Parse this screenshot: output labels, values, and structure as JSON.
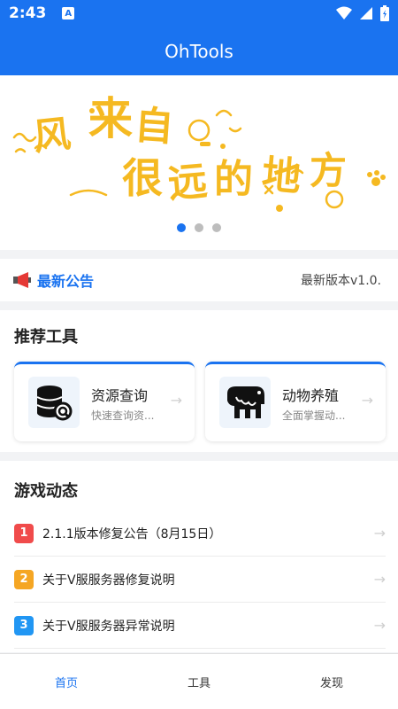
{
  "status_bar": {
    "time": "2:43",
    "notification_icon": "A",
    "icons": [
      "wifi-icon",
      "signal-icon",
      "battery-icon"
    ]
  },
  "app_bar": {
    "title": "OhTools"
  },
  "banner": {
    "art_text": "风来自很远的地方",
    "slides": 3,
    "active_slide": 0
  },
  "notice": {
    "icon": "megaphone-icon",
    "label": "最新公告",
    "version_text": "最新版本v1.0."
  },
  "tools": {
    "title": "推荐工具",
    "items": [
      {
        "name": "资源查询",
        "desc": "快速查询资...",
        "icon": "database-search-icon"
      },
      {
        "name": "动物养殖",
        "desc": "全面掌握动...",
        "icon": "animal-icon"
      }
    ]
  },
  "news": {
    "title": "游戏动态",
    "items": [
      {
        "num": "1",
        "text": "2.1.1版本修复公告（8月15日）",
        "color": "#f04b4b"
      },
      {
        "num": "2",
        "text": "关于V服服务器修复说明",
        "color": "#f5a623"
      },
      {
        "num": "3",
        "text": "关于V服服务器异常说明",
        "color": "#2196f3"
      }
    ]
  },
  "tabbar": {
    "tabs": [
      "首页",
      "工具",
      "发现"
    ],
    "active": 0
  },
  "colors": {
    "primary": "#1a73f0",
    "banner_art": "#f5b921"
  }
}
